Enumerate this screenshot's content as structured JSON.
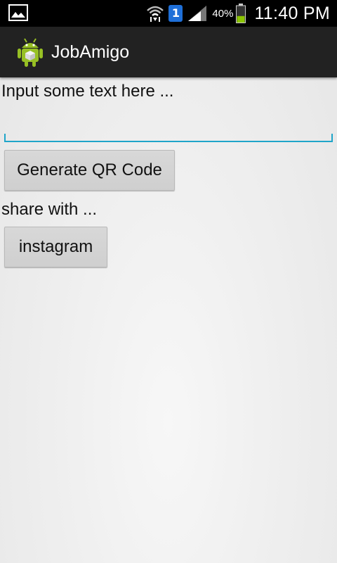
{
  "status_bar": {
    "notification_icon": "image-icon",
    "wifi_icon": "wifi-icon",
    "sim_label": "1",
    "signal_icon": "signal-icon",
    "battery_percent": "40%",
    "battery_level": 0.4,
    "battery_color": "#8bc500",
    "time": "11:40 PM"
  },
  "action_bar": {
    "app_icon": "android-icon",
    "title": "JobAmigo"
  },
  "main": {
    "input_prompt": "Input some text here ...",
    "text_field_value": "",
    "text_field_underline_color": "#1fa5c9",
    "generate_button_label": "Generate QR Code",
    "share_label": "share with ...",
    "instagram_button_label": "instagram"
  }
}
